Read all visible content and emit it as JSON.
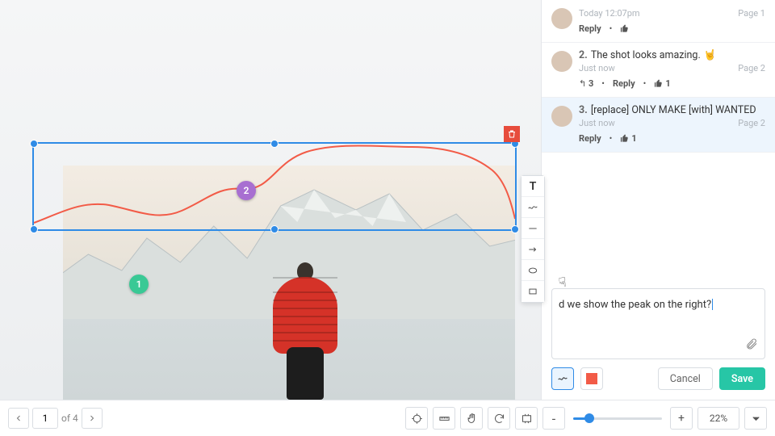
{
  "canvas": {
    "annotation_pins": {
      "1": "1",
      "2": "2"
    },
    "delete_tooltip": "Delete"
  },
  "comments": [
    {
      "num": "",
      "text": "",
      "time": "Today 12:07pm",
      "page": "Page 1",
      "reply": "Reply",
      "replies": "",
      "likes": ""
    },
    {
      "num": "2.",
      "text": "The shot looks amazing.",
      "emoji": "🤘",
      "time": "Just now",
      "page": "Page 2",
      "reply": "Reply",
      "replies": "3",
      "likes": "1"
    },
    {
      "num": "3.",
      "text": "[replace] ONLY MAKE [with] WANTED",
      "time": "Just now",
      "page": "Page 2",
      "reply": "Reply",
      "replies": "",
      "likes": "1"
    }
  ],
  "editor": {
    "input_text": "d we show the peak on the right?",
    "cancel": "Cancel",
    "save": "Save",
    "swatch_color": "#f25b47"
  },
  "pager": {
    "current": "1",
    "of_label": "of 4"
  },
  "zoom": {
    "value": "22%",
    "minus": "-",
    "plus": "+"
  }
}
